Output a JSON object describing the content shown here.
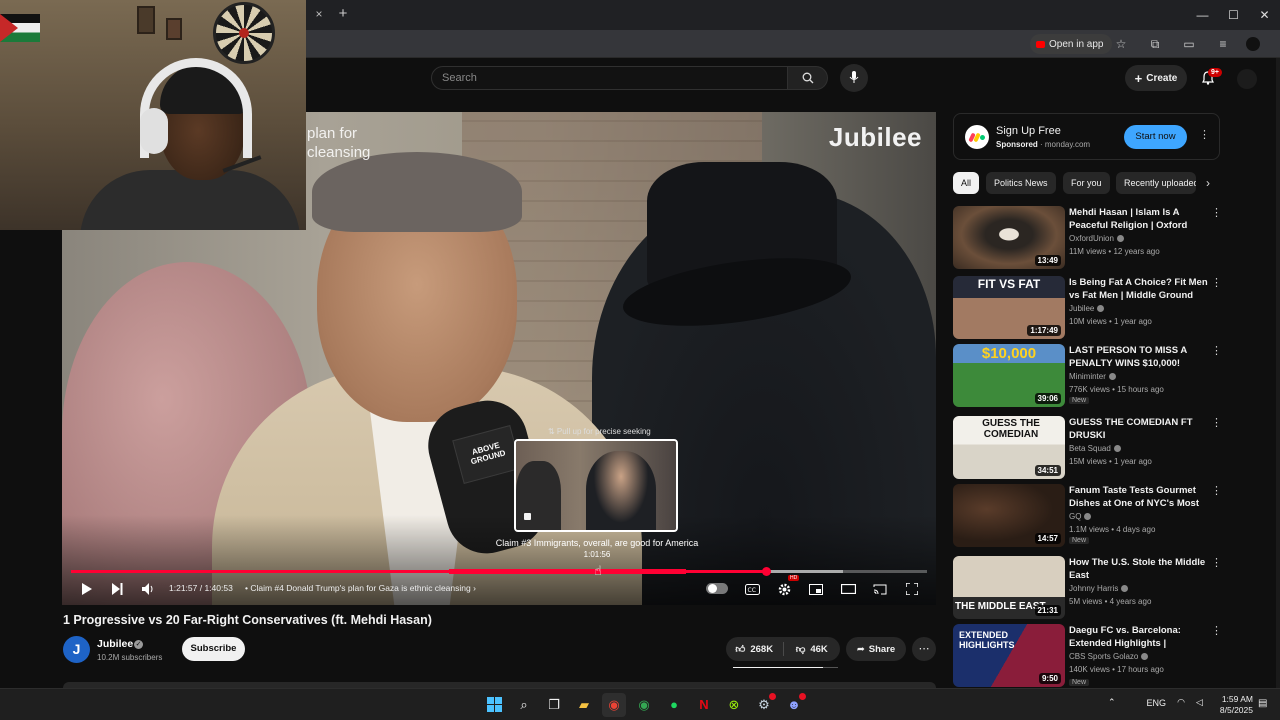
{
  "browser": {
    "tab_close": "×",
    "new_tab": "+",
    "window_controls": [
      "—",
      "☐",
      "✕"
    ],
    "open_in_app": "Open in app"
  },
  "header": {
    "search_placeholder": "Search",
    "create_label": "Create",
    "notification_badge": "9+"
  },
  "player": {
    "overlay_text": "plan for\ncleansing",
    "watermark": "Jubilee",
    "mic_flag": "ABOVE\nGROUND",
    "seek_hint": "⇅ Pull up for precise seeking",
    "preview_chapter": "Claim #3 Immigrants, overall, are good for America",
    "preview_time": "1:01:56",
    "time_current": "1:21:57",
    "time_total": "1:40:53",
    "time_display": "1:21:57 / 1:40:53",
    "current_chapter": "Claim #4 Donald Trump's plan for Gaza is ethnic cleansing",
    "played_fraction": 0.812,
    "accent": "#ff0033"
  },
  "video": {
    "title": "1 Progressive vs 20 Far-Right Conservatives (ft. Mehdi Hasan)",
    "channel": "Jubilee",
    "channel_initial": "J",
    "subscribers": "10.2M subscribers",
    "subscribe_label": "Subscribe",
    "likes": "268K",
    "dislikes": "46K",
    "share_label": "Share",
    "like_ratio": 0.853
  },
  "sidebar": {
    "ad": {
      "title": "Sign Up Free",
      "sponsored": "Sponsored",
      "domain": " · monday.com",
      "cta": "Start now"
    },
    "chips": [
      "All",
      "Politics News",
      "For you",
      "Recently uploaded"
    ],
    "recommendations": [
      {
        "title": "Mehdi Hasan | Islam Is A Peaceful Religion | Oxford Union",
        "channel": "OxfordUnion",
        "meta": "11M views • 12 years ago",
        "duration": "13:49",
        "badge": ""
      },
      {
        "title": "Is Being Fat A Choice? Fit Men vs Fat Men | Middle Ground",
        "channel": "Jubilee",
        "meta": "10M views • 1 year ago",
        "duration": "1:17:49",
        "badge": "",
        "thumb_text": "FIT VS FAT"
      },
      {
        "title": "LAST PERSON TO MISS A PENALTY WINS $10,000!",
        "channel": "Miniminter",
        "meta": "776K views • 15 hours ago",
        "duration": "39:06",
        "badge": "New",
        "thumb_text": "$10,000"
      },
      {
        "title": "GUESS THE COMEDIAN FT DRUSKI",
        "channel": "Beta Squad",
        "meta": "15M views • 1 year ago",
        "duration": "34:51",
        "badge": "",
        "thumb_text": "GUESS THE COMEDIAN"
      },
      {
        "title": "Fanum Taste Tests Gourmet Dishes at One of NYC's Most ...",
        "channel": "GQ",
        "meta": "1.1M views • 4 days ago",
        "duration": "14:57",
        "badge": "New"
      },
      {
        "title": "How The U.S. Stole the Middle East",
        "channel": "Johnny Harris",
        "meta": "5M views • 4 years ago",
        "duration": "21:31",
        "badge": "",
        "thumb_text": "THE MIDDLE EAST"
      },
      {
        "title": "Daegu FC vs. Barcelona: Extended Highlights | Summer...",
        "channel": "CBS Sports Golazo",
        "meta": "140K views • 17 hours ago",
        "duration": "9:50",
        "badge": "New",
        "thumb_text": "EXTENDED HIGHLIGHTS"
      }
    ]
  },
  "taskbar": {
    "language": "ENG",
    "time": "1:59 AM",
    "date": "8/5/2025"
  }
}
